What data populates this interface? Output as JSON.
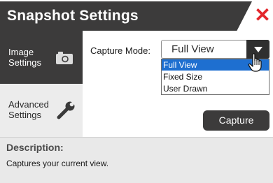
{
  "window": {
    "title": "Snapshot Settings",
    "close_symbol": "✕"
  },
  "sidebar": {
    "items": [
      {
        "label_line1": "Image",
        "label_line2": "Settings",
        "icon": "camera-icon",
        "selected": true
      },
      {
        "label_line1": "Advanced",
        "label_line2": "Settings",
        "icon": "wrench-icon",
        "selected": false
      }
    ]
  },
  "capture_mode": {
    "label": "Capture Mode:",
    "selected": "Full View",
    "options": [
      "Full View",
      "Fixed Size",
      "User Drawn"
    ],
    "highlighted_option": "Full View"
  },
  "actions": {
    "capture_label": "Capture"
  },
  "description": {
    "title": "Description:",
    "text": "Captures your current view."
  },
  "colors": {
    "dark": "#3c3b3b",
    "close": "#e3262b",
    "highlight": "#1e6fd0",
    "description_bg": "#e9e9e9"
  }
}
